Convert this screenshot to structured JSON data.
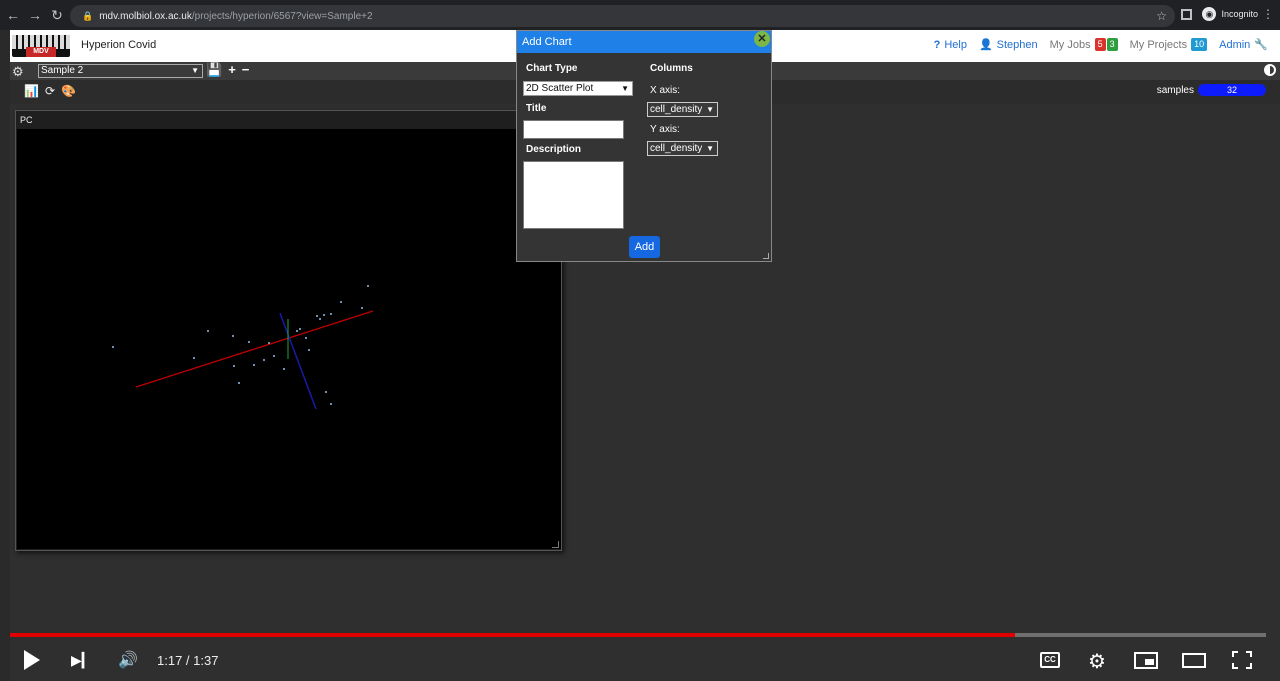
{
  "browser": {
    "url_host": "mdv.molbiol.ox.ac.uk",
    "url_path": "/projects/hyperion/6567?view=Sample+2",
    "incognito_label": "Incognito"
  },
  "header": {
    "logo_text": "MDV",
    "app_title": "Hyperion Covid",
    "help": "Help",
    "user": "Stephen",
    "my_jobs": "My Jobs",
    "jobs_red": "5",
    "jobs_green": "3",
    "my_projects": "My Projects",
    "projects_count": "10",
    "admin": "Admin"
  },
  "toolbar": {
    "view_selected": "Sample 2",
    "samples_label": "samples",
    "samples_count": "32"
  },
  "panel": {
    "title": "PC"
  },
  "dialog": {
    "title": "Add Chart",
    "chart_type_label": "Chart Type",
    "chart_type_value": "2D Scatter Plot",
    "title_label": "Title",
    "description_label": "Description",
    "columns_label": "Columns",
    "x_axis_label": "X axis:",
    "x_axis_value": "cell_density",
    "y_axis_label": "Y axis:",
    "y_axis_value": "cell_density",
    "add_button": "Add"
  },
  "player": {
    "time": "1:17 / 1:37",
    "progress_fraction": 0.8
  },
  "colors": {
    "dialog_header": "#1f80e8",
    "add_button": "#1568e0",
    "progress": "#e00000",
    "samples_bar": "#0d1bff"
  }
}
